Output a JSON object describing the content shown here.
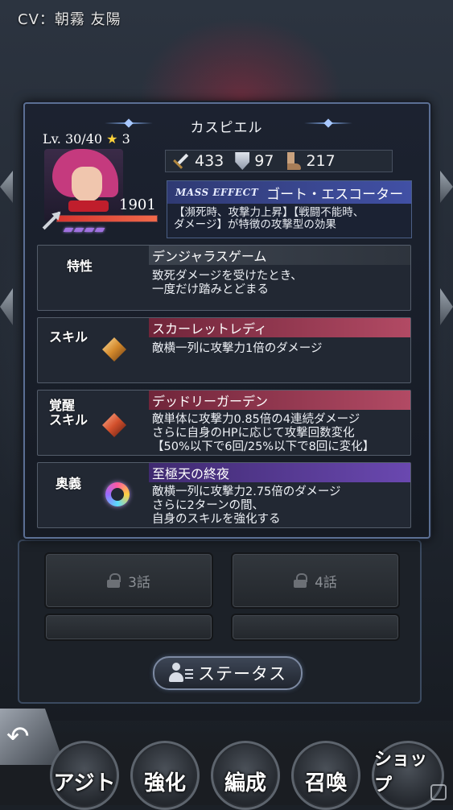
{
  "header": {
    "cv_text": "CV：朝霧 友陽"
  },
  "popup": {
    "title": "カスピエル",
    "level": "Lv. 30/40",
    "rarity": "3",
    "hp": "1901",
    "hp_ratio": 1.0,
    "gauge_segments": 4,
    "stats": {
      "attack": "433",
      "defense": "97",
      "speed": "217"
    },
    "mass_effect": {
      "label": "MASS EFFECT",
      "name": "ゴート・エスコーター",
      "desc1": "【瀕死時、攻撃力上昇】【戦闘不能時、",
      "desc2": "ダメージ】が特徴の攻撃型の効果"
    },
    "trait": {
      "label": "特性",
      "name": "デンジャラスゲーム",
      "lines": [
        "致死ダメージを受けたとき、",
        "一度だけ踏みとどまる"
      ]
    },
    "skill": {
      "label": "スキル",
      "name": "スカーレットレディ",
      "lines": [
        "敵横一列に攻撃力1倍のダメージ"
      ]
    },
    "awaken_skill": {
      "label1": "覚醒",
      "label2": "スキル",
      "name": "デッドリーガーデン",
      "lines": [
        "敵単体に攻撃力0.85倍の4連続ダメージ",
        "さらに自身のHPに応じて攻撃回数変化",
        "【50%以下で6回/25%以下で8回に変化】"
      ]
    },
    "ougi": {
      "label": "奥義",
      "name": "至極天の終夜",
      "lines": [
        "敵横一列に攻撃力2.75倍のダメージ",
        "さらに2ターンの間、",
        "自身のスキルを強化する"
      ]
    }
  },
  "chapters": {
    "left": "3話",
    "right": "4話"
  },
  "status_button": "ステータス",
  "nav": {
    "back": "↶",
    "items": [
      "アジト",
      "強化",
      "編成",
      "召喚",
      "ショップ"
    ]
  },
  "colors": {
    "hp_bar": "#d7342f",
    "skill_head": "#b24a64",
    "ougi_head": "#6a48b0",
    "mass_head": "#4150a5"
  }
}
